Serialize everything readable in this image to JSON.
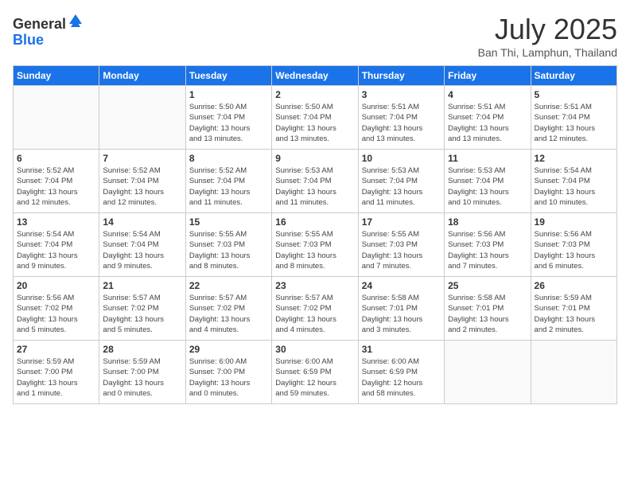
{
  "header": {
    "logo_line1": "General",
    "logo_line2": "Blue",
    "month": "July 2025",
    "location": "Ban Thi, Lamphun, Thailand"
  },
  "weekdays": [
    "Sunday",
    "Monday",
    "Tuesday",
    "Wednesday",
    "Thursday",
    "Friday",
    "Saturday"
  ],
  "weeks": [
    [
      {
        "day": "",
        "info": ""
      },
      {
        "day": "",
        "info": ""
      },
      {
        "day": "1",
        "info": "Sunrise: 5:50 AM\nSunset: 7:04 PM\nDaylight: 13 hours\nand 13 minutes."
      },
      {
        "day": "2",
        "info": "Sunrise: 5:50 AM\nSunset: 7:04 PM\nDaylight: 13 hours\nand 13 minutes."
      },
      {
        "day": "3",
        "info": "Sunrise: 5:51 AM\nSunset: 7:04 PM\nDaylight: 13 hours\nand 13 minutes."
      },
      {
        "day": "4",
        "info": "Sunrise: 5:51 AM\nSunset: 7:04 PM\nDaylight: 13 hours\nand 13 minutes."
      },
      {
        "day": "5",
        "info": "Sunrise: 5:51 AM\nSunset: 7:04 PM\nDaylight: 13 hours\nand 12 minutes."
      }
    ],
    [
      {
        "day": "6",
        "info": "Sunrise: 5:52 AM\nSunset: 7:04 PM\nDaylight: 13 hours\nand 12 minutes."
      },
      {
        "day": "7",
        "info": "Sunrise: 5:52 AM\nSunset: 7:04 PM\nDaylight: 13 hours\nand 12 minutes."
      },
      {
        "day": "8",
        "info": "Sunrise: 5:52 AM\nSunset: 7:04 PM\nDaylight: 13 hours\nand 11 minutes."
      },
      {
        "day": "9",
        "info": "Sunrise: 5:53 AM\nSunset: 7:04 PM\nDaylight: 13 hours\nand 11 minutes."
      },
      {
        "day": "10",
        "info": "Sunrise: 5:53 AM\nSunset: 7:04 PM\nDaylight: 13 hours\nand 11 minutes."
      },
      {
        "day": "11",
        "info": "Sunrise: 5:53 AM\nSunset: 7:04 PM\nDaylight: 13 hours\nand 10 minutes."
      },
      {
        "day": "12",
        "info": "Sunrise: 5:54 AM\nSunset: 7:04 PM\nDaylight: 13 hours\nand 10 minutes."
      }
    ],
    [
      {
        "day": "13",
        "info": "Sunrise: 5:54 AM\nSunset: 7:04 PM\nDaylight: 13 hours\nand 9 minutes."
      },
      {
        "day": "14",
        "info": "Sunrise: 5:54 AM\nSunset: 7:04 PM\nDaylight: 13 hours\nand 9 minutes."
      },
      {
        "day": "15",
        "info": "Sunrise: 5:55 AM\nSunset: 7:03 PM\nDaylight: 13 hours\nand 8 minutes."
      },
      {
        "day": "16",
        "info": "Sunrise: 5:55 AM\nSunset: 7:03 PM\nDaylight: 13 hours\nand 8 minutes."
      },
      {
        "day": "17",
        "info": "Sunrise: 5:55 AM\nSunset: 7:03 PM\nDaylight: 13 hours\nand 7 minutes."
      },
      {
        "day": "18",
        "info": "Sunrise: 5:56 AM\nSunset: 7:03 PM\nDaylight: 13 hours\nand 7 minutes."
      },
      {
        "day": "19",
        "info": "Sunrise: 5:56 AM\nSunset: 7:03 PM\nDaylight: 13 hours\nand 6 minutes."
      }
    ],
    [
      {
        "day": "20",
        "info": "Sunrise: 5:56 AM\nSunset: 7:02 PM\nDaylight: 13 hours\nand 5 minutes."
      },
      {
        "day": "21",
        "info": "Sunrise: 5:57 AM\nSunset: 7:02 PM\nDaylight: 13 hours\nand 5 minutes."
      },
      {
        "day": "22",
        "info": "Sunrise: 5:57 AM\nSunset: 7:02 PM\nDaylight: 13 hours\nand 4 minutes."
      },
      {
        "day": "23",
        "info": "Sunrise: 5:57 AM\nSunset: 7:02 PM\nDaylight: 13 hours\nand 4 minutes."
      },
      {
        "day": "24",
        "info": "Sunrise: 5:58 AM\nSunset: 7:01 PM\nDaylight: 13 hours\nand 3 minutes."
      },
      {
        "day": "25",
        "info": "Sunrise: 5:58 AM\nSunset: 7:01 PM\nDaylight: 13 hours\nand 2 minutes."
      },
      {
        "day": "26",
        "info": "Sunrise: 5:59 AM\nSunset: 7:01 PM\nDaylight: 13 hours\nand 2 minutes."
      }
    ],
    [
      {
        "day": "27",
        "info": "Sunrise: 5:59 AM\nSunset: 7:00 PM\nDaylight: 13 hours\nand 1 minute."
      },
      {
        "day": "28",
        "info": "Sunrise: 5:59 AM\nSunset: 7:00 PM\nDaylight: 13 hours\nand 0 minutes."
      },
      {
        "day": "29",
        "info": "Sunrise: 6:00 AM\nSunset: 7:00 PM\nDaylight: 13 hours\nand 0 minutes."
      },
      {
        "day": "30",
        "info": "Sunrise: 6:00 AM\nSunset: 6:59 PM\nDaylight: 12 hours\nand 59 minutes."
      },
      {
        "day": "31",
        "info": "Sunrise: 6:00 AM\nSunset: 6:59 PM\nDaylight: 12 hours\nand 58 minutes."
      },
      {
        "day": "",
        "info": ""
      },
      {
        "day": "",
        "info": ""
      }
    ]
  ]
}
